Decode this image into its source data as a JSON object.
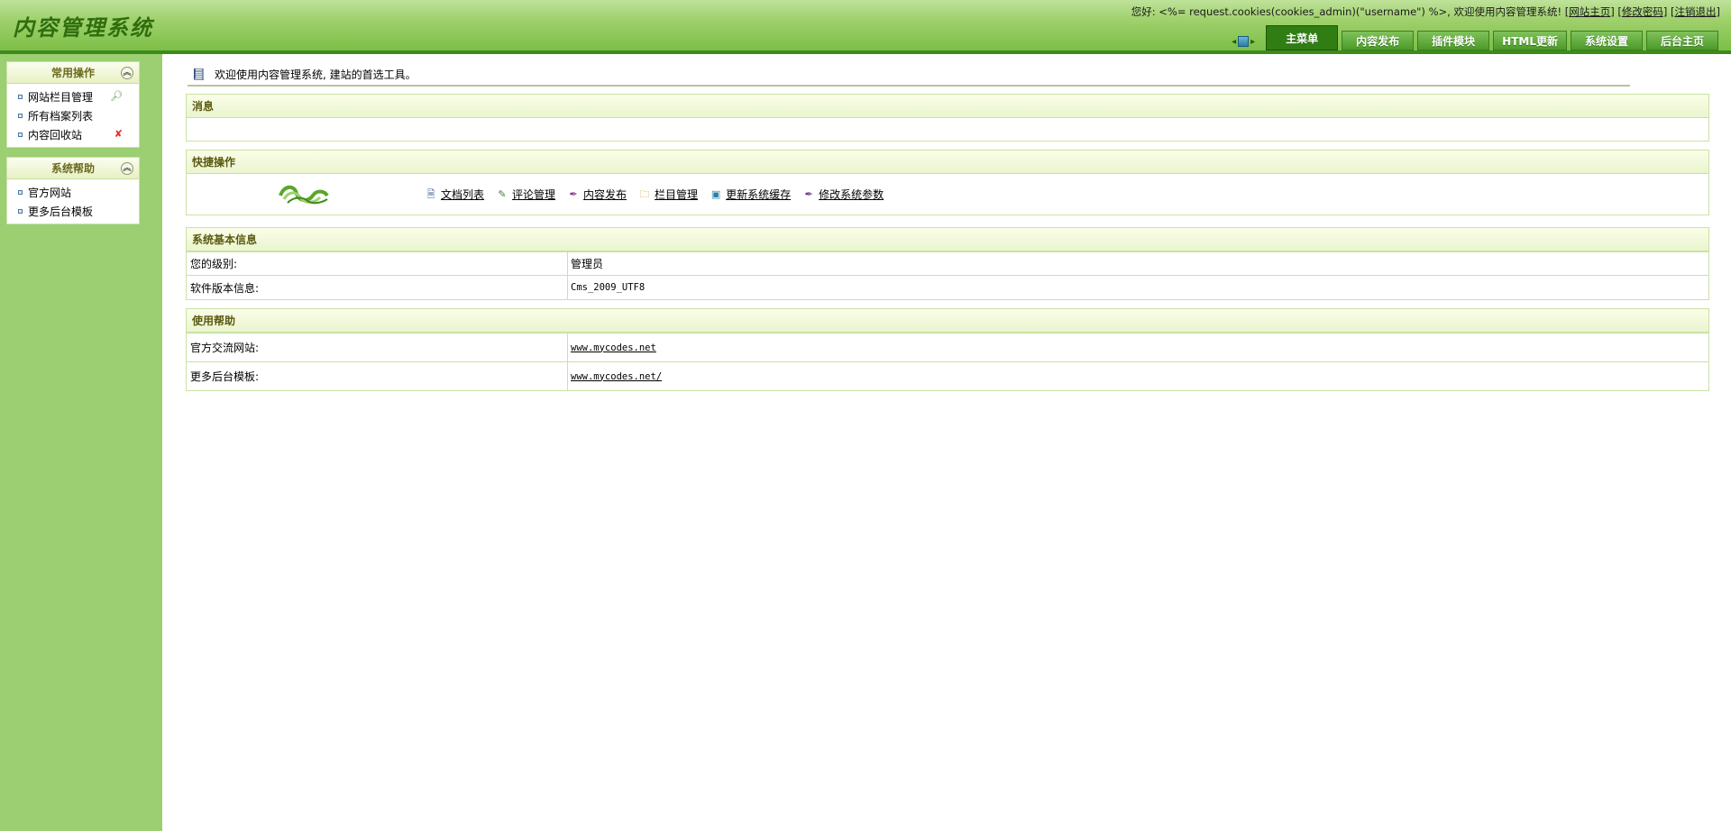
{
  "header": {
    "logo": "内容管理系统",
    "welcome_prefix": "您好: <%= request.cookies(cookies_admin)(\"username\") %>, 欢迎使用内容管理系统! ",
    "links": [
      {
        "label": "网站主页"
      },
      {
        "label": "修改密码"
      },
      {
        "label": "注销退出"
      }
    ],
    "tabs": [
      {
        "label": "主菜单",
        "active": true
      },
      {
        "label": "内容发布",
        "active": false
      },
      {
        "label": "插件模块",
        "active": false
      },
      {
        "label": "HTML更新",
        "active": false
      },
      {
        "label": "系统设置",
        "active": false
      },
      {
        "label": "后台主页",
        "active": false
      }
    ]
  },
  "sidebar": {
    "panels": [
      {
        "title": "常用操作",
        "items": [
          {
            "label": "网站栏目管理",
            "icon": "view-icon"
          },
          {
            "label": "所有档案列表",
            "icon": ""
          },
          {
            "label": "内容回收站",
            "icon": "delete-icon"
          }
        ]
      },
      {
        "title": "系统帮助",
        "items": [
          {
            "label": "官方网站"
          },
          {
            "label": "更多后台模板"
          }
        ]
      }
    ]
  },
  "main": {
    "greeting": "欢迎使用内容管理系统, 建站的首选工具。",
    "messages": {
      "title": "消息"
    },
    "quick": {
      "title": "快捷操作",
      "links": [
        {
          "label": "文档列表",
          "icon": "document-icon"
        },
        {
          "label": "评论管理",
          "icon": "comment-icon"
        },
        {
          "label": "内容发布",
          "icon": "pen-icon"
        },
        {
          "label": "栏目管理",
          "icon": "folder-icon"
        },
        {
          "label": "更新系统缓存",
          "icon": "refresh-icon"
        },
        {
          "label": "修改系统参数",
          "icon": "settings-pen-icon"
        }
      ]
    },
    "sysinfo": {
      "title": "系统基本信息",
      "rows": [
        {
          "label": "您的级别:",
          "value": "管理员"
        },
        {
          "label": "软件版本信息:",
          "value": "Cms_2009_UTF8"
        }
      ]
    },
    "help": {
      "title": "使用帮助",
      "rows": [
        {
          "label": "官方交流网站:",
          "value": "www.mycodes.net"
        },
        {
          "label": "更多后台模板:",
          "value": "www.mycodes.net/"
        }
      ]
    }
  },
  "colors": {
    "header_green": "#7cbf46",
    "sidebar_green": "#9bcf71",
    "tab_active": "#2f7d13",
    "section_border": "#c9e2a4"
  }
}
